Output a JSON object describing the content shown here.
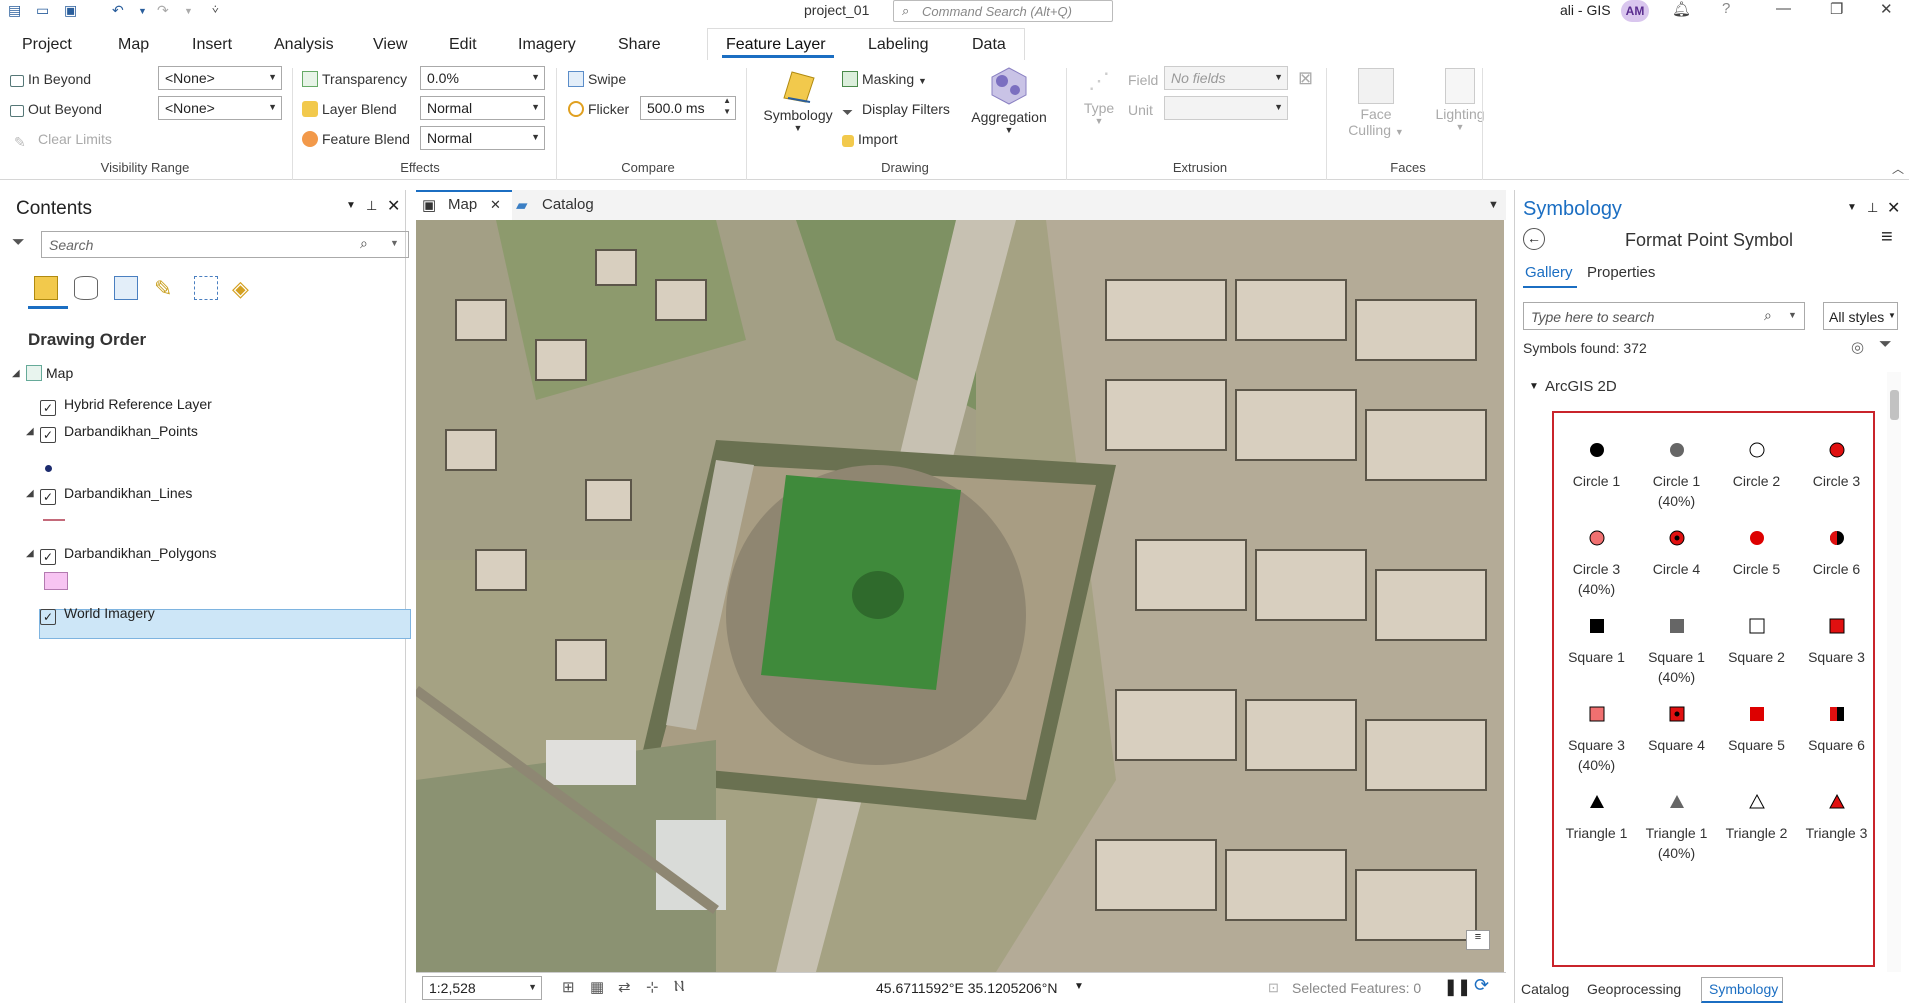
{
  "titlebar": {
    "project_name": "project_01",
    "command_search_placeholder": "Command Search (Alt+Q)",
    "user": "ali - GIS",
    "avatar_initials": "AM"
  },
  "ribbon_tabs": [
    "Project",
    "Map",
    "Insert",
    "Analysis",
    "View",
    "Edit",
    "Imagery",
    "Share",
    "Feature Layer",
    "Labeling",
    "Data"
  ],
  "active_tab": "Feature Layer",
  "ribbon": {
    "visibility": {
      "in_beyond": "In Beyond",
      "out_beyond": "Out Beyond",
      "clear_limits": "Clear Limits",
      "in_value": "<None>",
      "out_value": "<None>",
      "group": "Visibility Range"
    },
    "effects": {
      "transparency": "Transparency",
      "transparency_value": "0.0%",
      "layer_blend": "Layer Blend",
      "layer_blend_value": "Normal",
      "feature_blend": "Feature Blend",
      "feature_blend_value": "Normal",
      "group": "Effects"
    },
    "compare": {
      "swipe": "Swipe",
      "flicker": "Flicker",
      "flicker_value": "500.0  ms",
      "group": "Compare"
    },
    "drawing": {
      "symbology": "Symbology",
      "masking": "Masking",
      "display_filters": "Display Filters",
      "import": "Import",
      "aggregation": "Aggregation",
      "group": "Drawing"
    },
    "extrusion": {
      "type": "Type",
      "field": "Field",
      "field_value": "No fields",
      "unit": "Unit",
      "group": "Extrusion"
    },
    "faces": {
      "face_culling": "Face Culling",
      "face": "Face",
      "culling": "Culling",
      "lighting": "Lighting",
      "group": "Faces"
    }
  },
  "contents": {
    "title": "Contents",
    "search_placeholder": "Search",
    "drawing_order": "Drawing Order",
    "layers": {
      "map": "Map",
      "hybrid": "Hybrid Reference Layer",
      "points": "Darbandikhan_Points",
      "lines": "Darbandikhan_Lines",
      "polygons": "Darbandikhan_Polygons",
      "imagery": "World Imagery"
    }
  },
  "map_view": {
    "tabs": [
      "Map",
      "Catalog"
    ],
    "scale": "1:2,528",
    "coordinates": "45.6711592°E 35.1205206°N",
    "selected_features": "Selected Features: 0"
  },
  "symbology": {
    "title": "Symbology",
    "subtitle": "Format Point Symbol",
    "tabs": [
      "Gallery",
      "Properties"
    ],
    "search_placeholder": "Type here to search",
    "styles_filter": "All styles",
    "symbols_found": "Symbols found: 372",
    "category": "ArcGIS 2D",
    "symbols": [
      {
        "label": "Circle 1",
        "sub": ""
      },
      {
        "label": "Circle 1",
        "sub": "(40%)"
      },
      {
        "label": "Circle 2",
        "sub": ""
      },
      {
        "label": "Circle 3",
        "sub": ""
      },
      {
        "label": "Circle 3",
        "sub": "(40%)"
      },
      {
        "label": "Circle 4",
        "sub": ""
      },
      {
        "label": "Circle 5",
        "sub": ""
      },
      {
        "label": "Circle 6",
        "sub": ""
      },
      {
        "label": "Square 1",
        "sub": ""
      },
      {
        "label": "Square 1",
        "sub": "(40%)"
      },
      {
        "label": "Square 2",
        "sub": ""
      },
      {
        "label": "Square 3",
        "sub": ""
      },
      {
        "label": "Square 3",
        "sub": "(40%)"
      },
      {
        "label": "Square 4",
        "sub": ""
      },
      {
        "label": "Square 5",
        "sub": ""
      },
      {
        "label": "Square 6",
        "sub": ""
      },
      {
        "label": "Triangle 1",
        "sub": ""
      },
      {
        "label": "Triangle 1",
        "sub": "(40%)"
      },
      {
        "label": "Triangle 2",
        "sub": ""
      },
      {
        "label": "Triangle 3",
        "sub": ""
      }
    ],
    "bottom_tabs": [
      "Catalog",
      "Geoprocessing",
      "Symbology"
    ]
  },
  "colors": {
    "accent": "#1b6ec2",
    "selection": "#cde6f7",
    "highlight_border": "#c9242b",
    "symbol_red": "#e01010"
  }
}
